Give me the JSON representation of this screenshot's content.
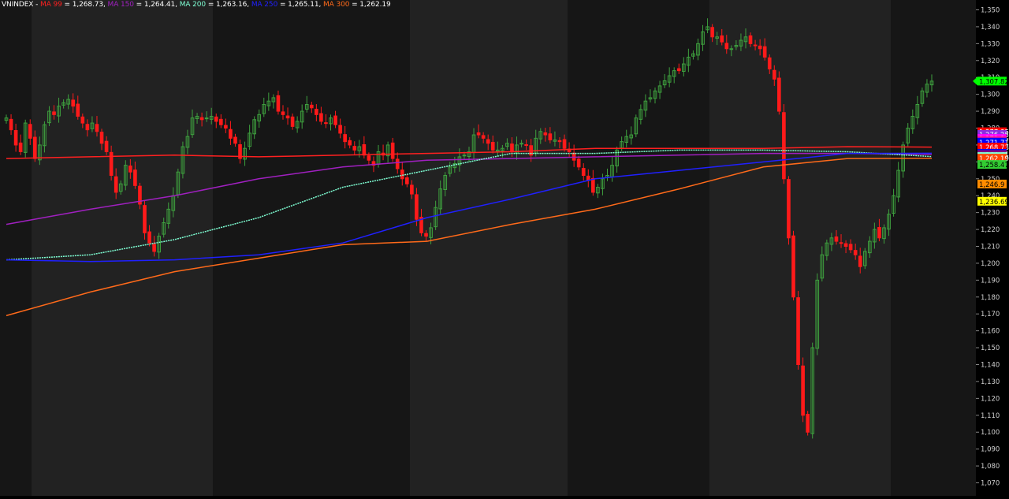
{
  "header": {
    "symbol": "VNINDEX",
    "separator": " - ",
    "ma_labels": [
      {
        "name": "MA 99",
        "value": "1,268.73",
        "color": "#ff2020"
      },
      {
        "name": "MA 150",
        "value": "1,264.41",
        "color": "#a020c0"
      },
      {
        "name": "MA 200",
        "value": "1,263.16",
        "color": "#7fffd4"
      },
      {
        "name": "MA 250",
        "value": "1,265.11",
        "color": "#2020ff"
      },
      {
        "name": "MA 300",
        "value": "1,262.19",
        "color": "#ff6a1a"
      }
    ]
  },
  "chart_data": {
    "type": "candlestick",
    "title": "VNINDEX",
    "ylim": [
      1070,
      1350
    ],
    "y_ticks": [
      "1,350",
      "1,340",
      "1,330",
      "1,320",
      "1,310",
      "1,300",
      "1,290",
      "1,280",
      "1,270",
      "1,260",
      "1,250",
      "1,240",
      "1,230",
      "1,220",
      "1,210",
      "1,200",
      "1,190",
      "1,180",
      "1,170",
      "1,160",
      "1,150",
      "1,140",
      "1,130",
      "1,120",
      "1,110",
      "1,100",
      "1,090",
      "1,080",
      "1,070"
    ],
    "grid": false,
    "background": "#161616",
    "band_color": "#222222",
    "up_color": "#3ea03e",
    "down_color": "#ff1a1a",
    "last_price": {
      "label": "1,307.82",
      "value": 1307.82,
      "color": "#00ff00"
    },
    "right_labels": [
      {
        "label": "1,277.85",
        "value": 1277.85,
        "color": "#ff0000"
      },
      {
        "label": "1,276.25",
        "value": 1276.25,
        "color": "#8a2be2"
      },
      {
        "label": "1,273.9",
        "value": 1273.9,
        "color": "#ff00ff"
      },
      {
        "label": "1,272.57",
        "value": 1272.57,
        "color": "#ff1493"
      },
      {
        "label": "1,271.71",
        "value": 1271.71,
        "color": "#0000ff"
      },
      {
        "label": "1,268.73",
        "value": 1268.73,
        "color": "#ff0000"
      },
      {
        "label": "1,265.11",
        "value": 1265.11,
        "color": "#0000ff"
      },
      {
        "label": "1,264.41",
        "value": 1264.41,
        "color": "#800080"
      },
      {
        "label": "1,263.16",
        "value": 1263.16,
        "color": "#7fffd4"
      },
      {
        "label": "1,262.19",
        "value": 1262.19,
        "color": "#ff4500"
      },
      {
        "label": "1,258.47",
        "value": 1258.47,
        "color": "#32cd32"
      },
      {
        "label": "1,246.9",
        "value": 1246.9,
        "color": "#ff8c00"
      },
      {
        "label": "1,236.69",
        "value": 1236.69,
        "color": "#ffff00"
      }
    ],
    "closes": [
      1286,
      1279,
      1270,
      1266,
      1283,
      1274,
      1262,
      1270,
      1282,
      1290,
      1288,
      1293,
      1295,
      1297,
      1293,
      1287,
      1283,
      1279,
      1283,
      1278,
      1271,
      1266,
      1252,
      1242,
      1247,
      1258,
      1254,
      1246,
      1235,
      1218,
      1212,
      1207,
      1216,
      1224,
      1232,
      1240,
      1254,
      1269,
      1275,
      1286,
      1287,
      1285,
      1286,
      1287,
      1284,
      1282,
      1280,
      1274,
      1271,
      1262,
      1268,
      1277,
      1285,
      1288,
      1294,
      1296,
      1298,
      1290,
      1288,
      1286,
      1281,
      1284,
      1290,
      1294,
      1292,
      1288,
      1284,
      1283,
      1286,
      1282,
      1277,
      1272,
      1270,
      1267,
      1269,
      1264,
      1261,
      1258,
      1266,
      1264,
      1270,
      1262,
      1256,
      1250,
      1247,
      1241,
      1226,
      1218,
      1216,
      1221,
      1233,
      1244,
      1252,
      1257,
      1259,
      1263,
      1264,
      1266,
      1276,
      1276,
      1274,
      1271,
      1267,
      1267,
      1268,
      1271,
      1266,
      1270,
      1271,
      1270,
      1264,
      1274,
      1278,
      1276,
      1273,
      1273,
      1272,
      1268,
      1266,
      1261,
      1257,
      1252,
      1249,
      1242,
      1245,
      1250,
      1252,
      1258,
      1267,
      1272,
      1275,
      1276,
      1286,
      1291,
      1296,
      1298,
      1302,
      1305,
      1308,
      1311,
      1314,
      1314,
      1318,
      1322,
      1324,
      1330,
      1337,
      1340,
      1334,
      1334,
      1331,
      1327,
      1327,
      1329,
      1332,
      1334,
      1330,
      1329,
      1327,
      1322,
      1315,
      1309,
      1290,
      1250,
      1215,
      1180,
      1140,
      1110,
      1100,
      1150,
      1190,
      1205,
      1212,
      1215,
      1213,
      1212,
      1210,
      1208,
      1205,
      1198,
      1207,
      1213,
      1220,
      1215,
      1221,
      1229,
      1240,
      1255,
      1270,
      1280,
      1287,
      1294,
      1302,
      1306,
      1307.82
    ],
    "moving_averages": [
      {
        "name": "MA 99",
        "label": "1,268.73",
        "color": "#ff2020",
        "values": [
          1262,
          1263,
          1264,
          1263,
          1264,
          1265,
          1266,
          1268,
          1268,
          1268,
          1269,
          1268.73
        ]
      },
      {
        "name": "MA 150",
        "label": "1,264.41",
        "color": "#a020c0",
        "values": [
          1223,
          1232,
          1240,
          1250,
          1257,
          1261,
          1262,
          1263,
          1264,
          1265,
          1265,
          1264.41
        ]
      },
      {
        "name": "MA 200",
        "label": "1,263.16",
        "color": "#7fffd4",
        "values": [
          1202,
          1205,
          1214,
          1227,
          1245,
          1255,
          1265,
          1265,
          1267,
          1267,
          1266,
          1263.16
        ]
      },
      {
        "name": "MA 250",
        "label": "1,265.11",
        "color": "#2020ff",
        "values": [
          1202,
          1201,
          1202,
          1205,
          1212,
          1227,
          1238,
          1250,
          1255,
          1260,
          1265,
          1265.11
        ]
      },
      {
        "name": "MA 300",
        "label": "1,262.19",
        "color": "#ff6a1a",
        "values": [
          1169,
          1183,
          1195,
          1203,
          1211,
          1213,
          1223,
          1232,
          1244,
          1257,
          1262,
          1262.19
        ]
      }
    ]
  }
}
